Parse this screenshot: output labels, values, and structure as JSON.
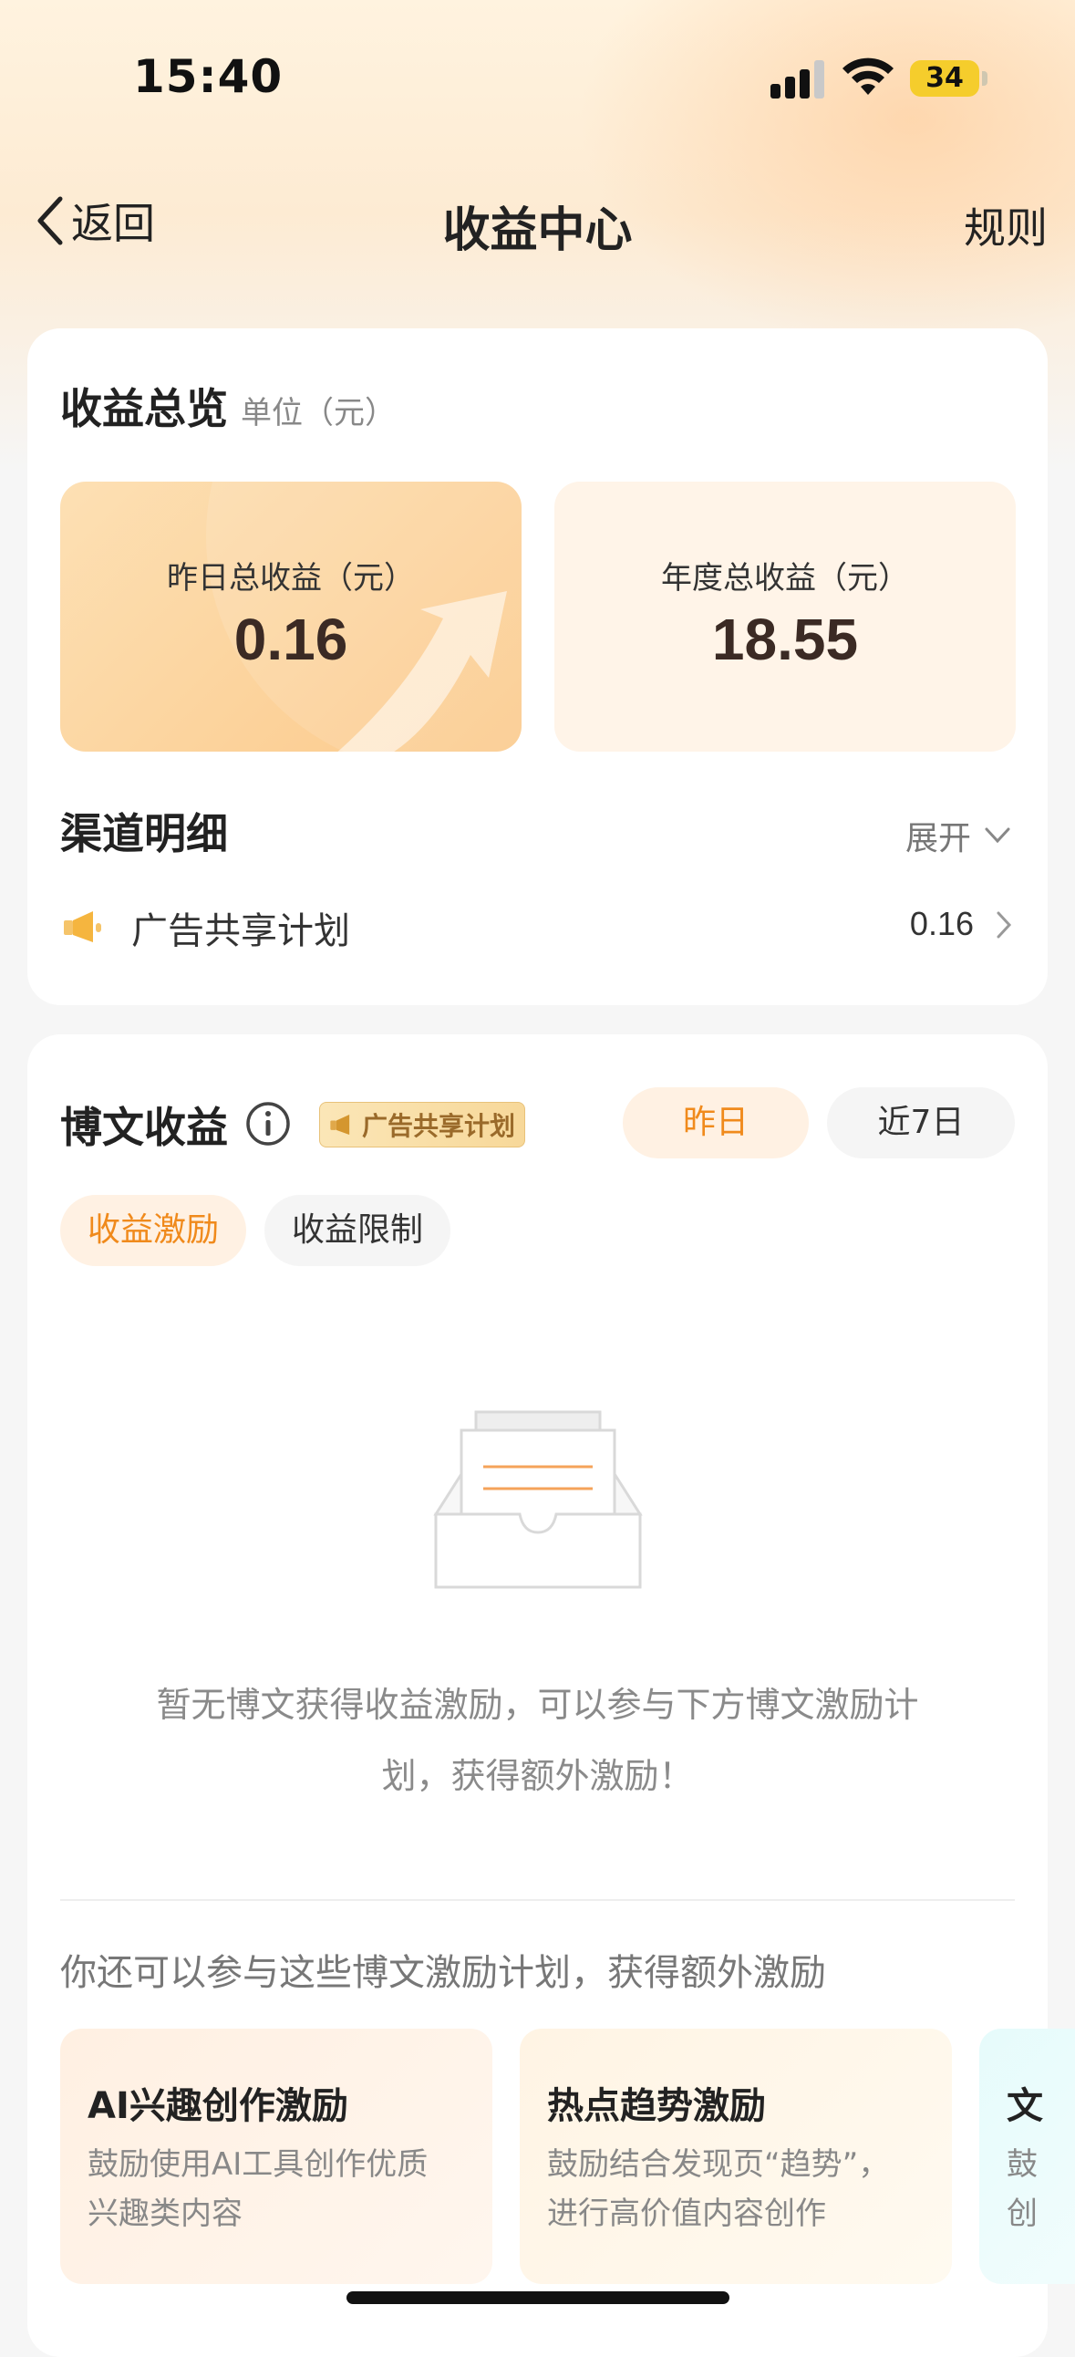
{
  "status_bar": {
    "time": "15:40",
    "battery": "34"
  },
  "nav": {
    "back_label": "返回",
    "title": "收益中心",
    "rules_label": "规则"
  },
  "overview": {
    "title": "收益总览",
    "unit": "单位（元）",
    "yesterday": {
      "label": "昨日总收益（元）",
      "value": "0.16"
    },
    "annual": {
      "label": "年度总收益（元）",
      "value": "18.55"
    }
  },
  "channel": {
    "title": "渠道明细",
    "expand_label": "展开",
    "items": [
      {
        "label": "广告共享计划",
        "value": "0.16"
      }
    ]
  },
  "blog": {
    "title": "博文收益",
    "badge": "广告共享计划",
    "period_tabs": [
      {
        "label": "昨日",
        "active": true
      },
      {
        "label": "近7日",
        "active": false
      }
    ],
    "type_tabs": [
      {
        "label": "收益激励",
        "active": true
      },
      {
        "label": "收益限制",
        "active": false
      }
    ],
    "empty_line1": "暂无博文获得收益激励，可以参与下方博文激励计",
    "empty_line2": "划，获得额外激励！",
    "extra_title": "你还可以参与这些博文激励计划，获得额外激励",
    "incentives": [
      {
        "title": "AI兴趣创作激励",
        "desc_line1": "鼓励使用AI工具创作优质",
        "desc_line2": "兴趣类内容"
      },
      {
        "title": "热点趋势激励",
        "desc_line1": "鼓励结合发现页“趋势”，",
        "desc_line2": "进行高价值内容创作"
      },
      {
        "title": "文",
        "desc_line1": "鼓",
        "desc_line2": "创"
      }
    ]
  },
  "colors": {
    "accent": "#f08a1c",
    "value_text": "#3b2a24",
    "battery": "#f5cd2c"
  }
}
